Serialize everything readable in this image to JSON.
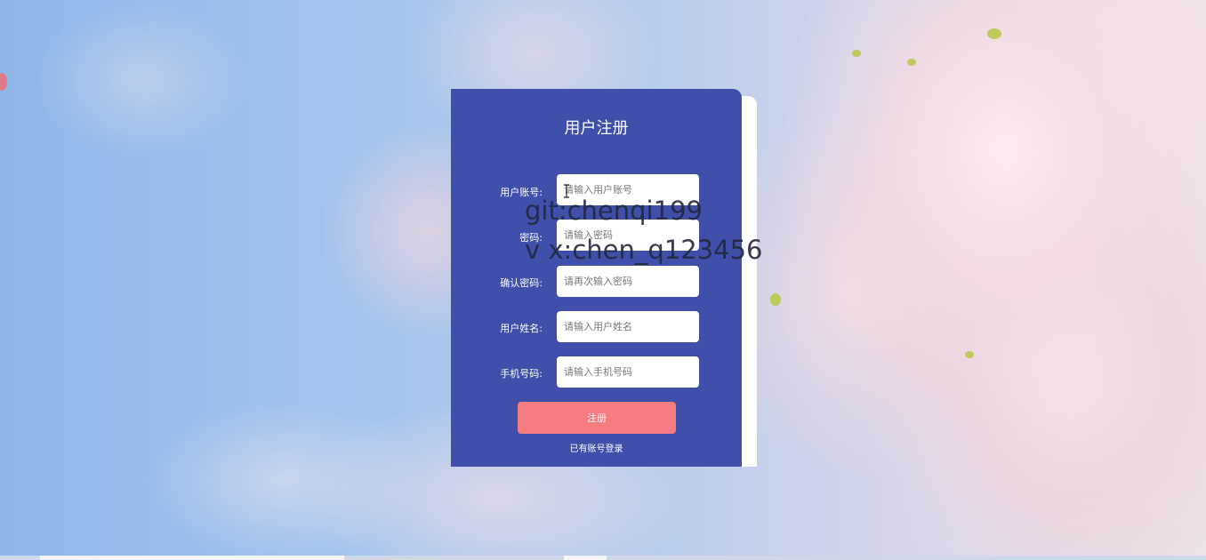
{
  "form": {
    "title": "用户注册",
    "fields": [
      {
        "label": "用户账号:",
        "placeholder": "请输入用户账号",
        "value": ""
      },
      {
        "label": "密码:",
        "placeholder": "请输入密码",
        "value": ""
      },
      {
        "label": "确认密码:",
        "placeholder": "请再次输入密码",
        "value": ""
      },
      {
        "label": "用户姓名:",
        "placeholder": "请输入用户姓名",
        "value": ""
      },
      {
        "label": "手机号码:",
        "placeholder": "请输入手机号码",
        "value": ""
      }
    ],
    "submit_label": "注册",
    "login_link": "已有账号登录"
  },
  "watermark": {
    "line1": "git:chenqi199",
    "line2": "v x:chen_q123456"
  },
  "colors": {
    "card": "#3f4faa",
    "button": "#f47b80"
  },
  "icons": {
    "cursor": "text-cursor-icon"
  }
}
